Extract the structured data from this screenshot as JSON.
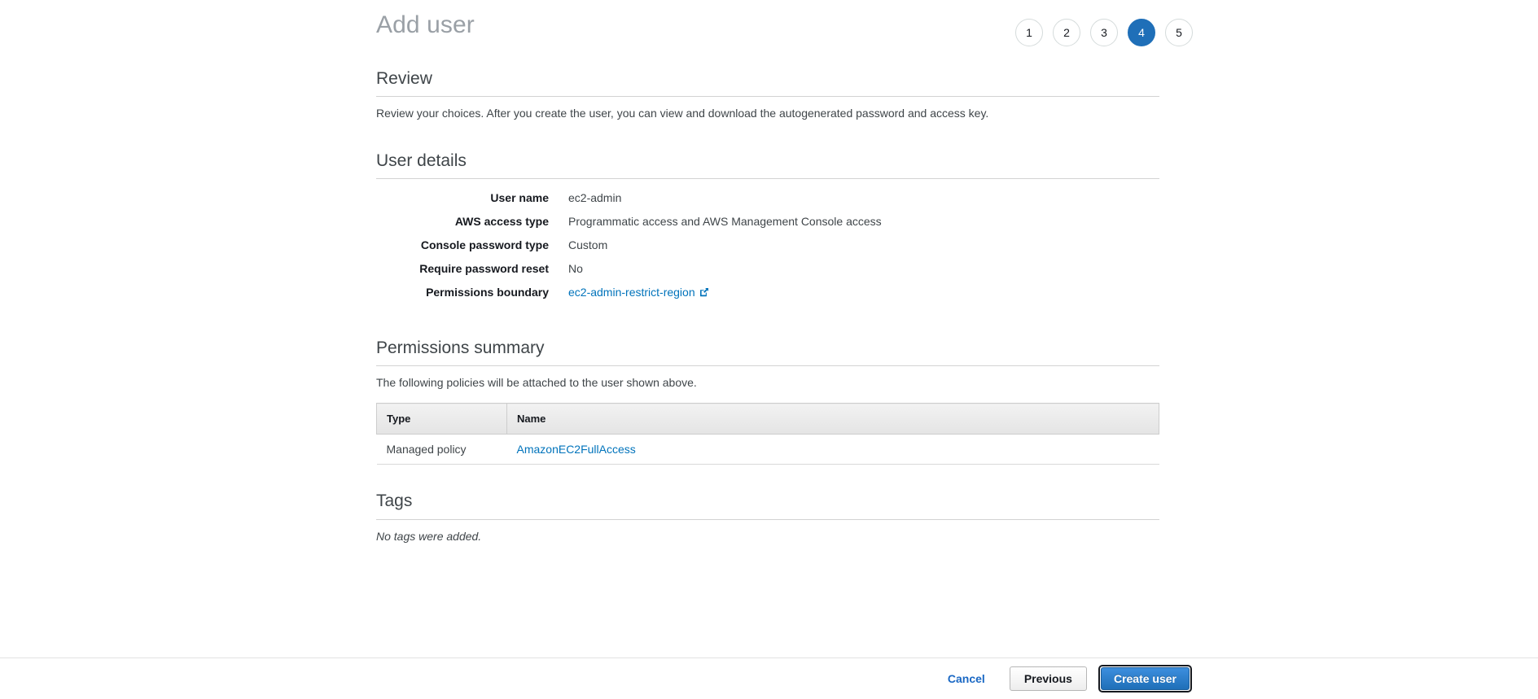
{
  "header": {
    "title": "Add user",
    "steps": [
      {
        "label": "1",
        "active": false
      },
      {
        "label": "2",
        "active": false
      },
      {
        "label": "3",
        "active": false
      },
      {
        "label": "4",
        "active": true
      },
      {
        "label": "5",
        "active": false
      }
    ],
    "active_step_color": "#1f6fb8"
  },
  "review": {
    "title": "Review",
    "description": "Review your choices. After you create the user, you can view and download the autogenerated password and access key."
  },
  "user_details": {
    "title": "User details",
    "rows": [
      {
        "label": "User name",
        "value": "ec2-admin",
        "is_link": false
      },
      {
        "label": "AWS access type",
        "value": "Programmatic access and AWS Management Console access",
        "is_link": false
      },
      {
        "label": "Console password type",
        "value": "Custom",
        "is_link": false
      },
      {
        "label": "Require password reset",
        "value": "No",
        "is_link": false
      },
      {
        "label": "Permissions boundary",
        "value": "ec2-admin-restrict-region",
        "is_link": true,
        "icon": "external-link-icon"
      }
    ]
  },
  "permissions_summary": {
    "title": "Permissions summary",
    "description": "The following policies will be attached to the user shown above.",
    "columns": [
      "Type",
      "Name"
    ],
    "rows": [
      {
        "type": "Managed policy",
        "name": "AmazonEC2FullAccess",
        "name_is_link": true
      }
    ]
  },
  "tags": {
    "title": "Tags",
    "empty_message": "No tags were added."
  },
  "footer": {
    "cancel_label": "Cancel",
    "previous_label": "Previous",
    "create_label": "Create user",
    "link_color": "#0073bb",
    "primary_color": "#1f6fb8"
  }
}
